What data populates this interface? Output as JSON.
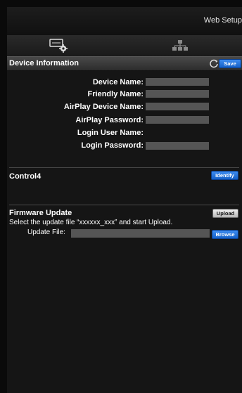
{
  "header": {
    "title": "Web Setup"
  },
  "tabs": [
    {
      "name": "settings",
      "icon": "settings-gear-icon"
    },
    {
      "name": "network",
      "icon": "network-icon"
    }
  ],
  "device_info": {
    "title": "Device Information",
    "save_label": "Save",
    "refresh_icon": "refresh-icon",
    "fields": [
      {
        "label": "Device Name:",
        "value": ""
      },
      {
        "label": "Friendly Name:",
        "value": ""
      },
      {
        "label": "AirPlay Device Name:",
        "value": ""
      },
      {
        "label": "AirPlay Password:",
        "value": ""
      },
      {
        "label": "Login User Name:",
        "value": ""
      },
      {
        "label": "Login Password:",
        "value": ""
      }
    ]
  },
  "control4": {
    "title": "Control4",
    "identify_label": "Identify"
  },
  "firmware": {
    "title": "Firmware Update",
    "upload_label": "Upload",
    "instruction": "Select the update file “xxxxxx_xxx” and start Upload.",
    "file_label": "Update File:",
    "browse_label": "Browse"
  },
  "colors": {
    "background": "#151515",
    "section_header": "#3a3a3a",
    "input_fill": "#555555",
    "accent_button": "#1f6fd8"
  }
}
